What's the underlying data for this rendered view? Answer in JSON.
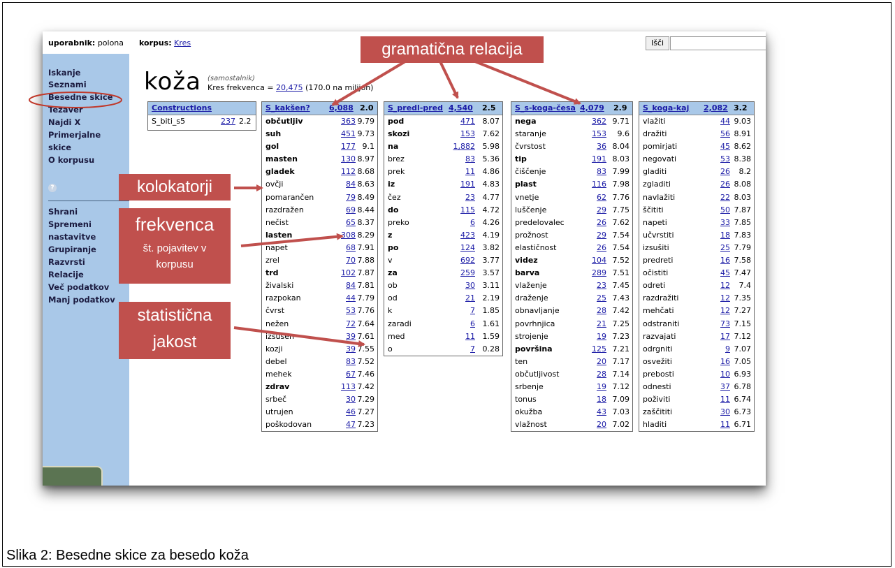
{
  "topbar": {
    "user_label": "uporabnik:",
    "user_value": "polona",
    "corpus_label": "korpus:",
    "corpus_value": "Kres",
    "search_button": "Išči"
  },
  "sidebar": {
    "items": [
      "Iskanje",
      "Seznami",
      "Besedne skice",
      "Tezaver",
      "Najdi X",
      "Primerjalne",
      "skice",
      "O korpusu"
    ],
    "help": "?",
    "items2": [
      "Shrani",
      "Spremeni",
      "nastavitve",
      "Grupiranje",
      "Razvrsti",
      "Relacije",
      "Več podatkov",
      "Manj podatkov"
    ]
  },
  "headword": {
    "word": "koža",
    "pos": "(samostalnik)",
    "freq_prefix": "Kres frekvenca =",
    "freq_link": "20,475",
    "freq_suffix": "(170.0 na milijon)"
  },
  "constructions": {
    "title": "Constructions",
    "row": {
      "word": "S_biti_s5",
      "freq": "237",
      "score": "2.2"
    }
  },
  "tables": [
    {
      "name": "S_kakšen?",
      "freq": "6,088",
      "score": "2.0",
      "rows": [
        [
          "občutljiv",
          "363",
          "9.79",
          1
        ],
        [
          "suh",
          "451",
          "9.73",
          1
        ],
        [
          "gol",
          "177",
          "9.1",
          1
        ],
        [
          "masten",
          "130",
          "8.97",
          1
        ],
        [
          "gladek",
          "112",
          "8.68",
          1
        ],
        [
          "ovčji",
          "84",
          "8.63",
          0
        ],
        [
          "pomarančen",
          "79",
          "8.49",
          0
        ],
        [
          "razdražen",
          "69",
          "8.44",
          0
        ],
        [
          "nečist",
          "65",
          "8.37",
          0
        ],
        [
          "lasten",
          "308",
          "8.29",
          1
        ],
        [
          "napet",
          "68",
          "7.91",
          0
        ],
        [
          "zrel",
          "70",
          "7.88",
          0
        ],
        [
          "trd",
          "102",
          "7.87",
          1
        ],
        [
          "živalski",
          "84",
          "7.81",
          0
        ],
        [
          "razpokan",
          "44",
          "7.79",
          0
        ],
        [
          "čvrst",
          "53",
          "7.76",
          0
        ],
        [
          "nežen",
          "72",
          "7.64",
          0
        ],
        [
          "izsušen",
          "39",
          "7.61",
          0
        ],
        [
          "kozji",
          "39",
          "7.55",
          0
        ],
        [
          "debel",
          "83",
          "7.52",
          0
        ],
        [
          "mehek",
          "67",
          "7.46",
          0
        ],
        [
          "zdrav",
          "113",
          "7.42",
          1
        ],
        [
          "srbeč",
          "30",
          "7.29",
          0
        ],
        [
          "utrujen",
          "46",
          "7.27",
          0
        ],
        [
          "poškodovan",
          "47",
          "7.23",
          0
        ]
      ]
    },
    {
      "name": "S_predl-pred",
      "freq": "4,540",
      "score": "2.5",
      "rows": [
        [
          "pod",
          "471",
          "8.07",
          1
        ],
        [
          "skozi",
          "153",
          "7.62",
          1
        ],
        [
          "na",
          "1,882",
          "5.98",
          1
        ],
        [
          "brez",
          "83",
          "5.36",
          0
        ],
        [
          "prek",
          "11",
          "4.86",
          0
        ],
        [
          "iz",
          "191",
          "4.83",
          1
        ],
        [
          "čez",
          "23",
          "4.77",
          0
        ],
        [
          "do",
          "115",
          "4.72",
          1
        ],
        [
          "preko",
          "6",
          "4.26",
          0
        ],
        [
          "z",
          "423",
          "4.19",
          1
        ],
        [
          "po",
          "124",
          "3.82",
          1
        ],
        [
          "v",
          "692",
          "3.77",
          0
        ],
        [
          "za",
          "259",
          "3.57",
          1
        ],
        [
          "ob",
          "30",
          "3.11",
          0
        ],
        [
          "od",
          "21",
          "2.19",
          0
        ],
        [
          "k",
          "7",
          "1.85",
          0
        ],
        [
          "zaradi",
          "6",
          "1.61",
          0
        ],
        [
          "med",
          "11",
          "1.59",
          0
        ],
        [
          "o",
          "7",
          "0.28",
          0
        ]
      ]
    },
    {
      "name": "S_s-koga-česa",
      "freq": "4,079",
      "score": "2.9",
      "rows": [
        [
          "nega",
          "362",
          "9.71",
          1
        ],
        [
          "staranje",
          "153",
          "9.6",
          0
        ],
        [
          "čvrstost",
          "36",
          "8.04",
          0
        ],
        [
          "tip",
          "191",
          "8.03",
          1
        ],
        [
          "čiščenje",
          "83",
          "7.99",
          0
        ],
        [
          "plast",
          "116",
          "7.98",
          1
        ],
        [
          "vnetje",
          "62",
          "7.76",
          0
        ],
        [
          "luščenje",
          "29",
          "7.75",
          0
        ],
        [
          "predelovalec",
          "26",
          "7.62",
          0
        ],
        [
          "prožnost",
          "29",
          "7.54",
          0
        ],
        [
          "elastičnost",
          "26",
          "7.54",
          0
        ],
        [
          "videz",
          "104",
          "7.52",
          1
        ],
        [
          "barva",
          "289",
          "7.51",
          1
        ],
        [
          "vlaženje",
          "23",
          "7.45",
          0
        ],
        [
          "draženje",
          "25",
          "7.43",
          0
        ],
        [
          "obnavljanje",
          "28",
          "7.42",
          0
        ],
        [
          "povrhnjica",
          "21",
          "7.25",
          0
        ],
        [
          "strojenje",
          "19",
          "7.23",
          0
        ],
        [
          "površina",
          "125",
          "7.21",
          1
        ],
        [
          "ten",
          "20",
          "7.17",
          0
        ],
        [
          "občutljivost",
          "28",
          "7.14",
          0
        ],
        [
          "srbenje",
          "19",
          "7.12",
          0
        ],
        [
          "tonus",
          "18",
          "7.09",
          0
        ],
        [
          "okužba",
          "43",
          "7.03",
          0
        ],
        [
          "vlažnost",
          "20",
          "7.02",
          0
        ]
      ]
    },
    {
      "name": "S_koga-kaj",
      "freq": "2,082",
      "score": "3.2",
      "rows": [
        [
          "vlažiti",
          "44",
          "9.03",
          0
        ],
        [
          "dražiti",
          "56",
          "8.91",
          0
        ],
        [
          "pomirjati",
          "45",
          "8.62",
          0
        ],
        [
          "negovati",
          "53",
          "8.38",
          0
        ],
        [
          "gladiti",
          "26",
          "8.2",
          0
        ],
        [
          "zgladiti",
          "26",
          "8.08",
          0
        ],
        [
          "navlažiti",
          "22",
          "8.03",
          0
        ],
        [
          "ščititi",
          "50",
          "7.87",
          0
        ],
        [
          "napeti",
          "33",
          "7.85",
          0
        ],
        [
          "učvrstiti",
          "18",
          "7.83",
          0
        ],
        [
          "izsušiti",
          "25",
          "7.79",
          0
        ],
        [
          "predreti",
          "16",
          "7.58",
          0
        ],
        [
          "očistiti",
          "45",
          "7.47",
          0
        ],
        [
          "odreti",
          "12",
          "7.4",
          0
        ],
        [
          "razdražiti",
          "12",
          "7.35",
          0
        ],
        [
          "mehčati",
          "12",
          "7.27",
          0
        ],
        [
          "odstraniti",
          "73",
          "7.15",
          0
        ],
        [
          "razvajati",
          "17",
          "7.12",
          0
        ],
        [
          "odrgniti",
          "9",
          "7.07",
          0
        ],
        [
          "osvežiti",
          "16",
          "7.05",
          0
        ],
        [
          "prebosti",
          "10",
          "6.93",
          0
        ],
        [
          "odnesti",
          "37",
          "6.78",
          0
        ],
        [
          "poživiti",
          "11",
          "6.74",
          0
        ],
        [
          "zaščititi",
          "30",
          "6.73",
          0
        ],
        [
          "hladiti",
          "11",
          "6.71",
          0
        ]
      ]
    }
  ],
  "annotations": {
    "gram": "gramatična relacija",
    "kolok": "kolokatorji",
    "frek_title": "frekvenca",
    "frek_sub1": "št. pojavitev v",
    "frek_sub2": "korpusu",
    "stat1": "statistična",
    "stat2": "jakost"
  },
  "caption": "Slika 2: Besedne skice za besedo koža",
  "colors": {
    "accent": "#c0504d",
    "sidebar": "#a9c8e8",
    "link": "#1a1aa6"
  }
}
